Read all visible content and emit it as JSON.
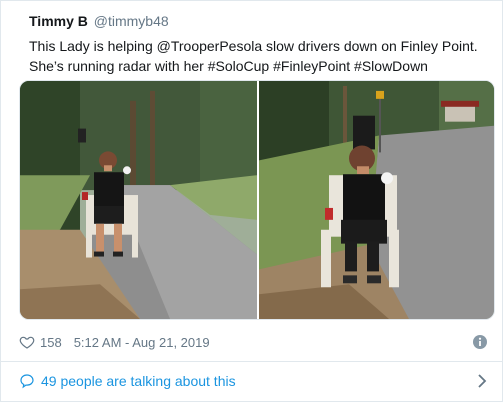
{
  "author": {
    "display_name": "Timmy B",
    "handle": "@timmyb48"
  },
  "tweet": {
    "line1": "This Lady is helping @TrooperPesola slow drivers down on Finley Point.",
    "line2": "She’s running radar with her #SoloCup #FinleyPoint #SlowDown"
  },
  "meta": {
    "like_count": "158",
    "timestamp": "5:12 AM - Aug 21, 2019"
  },
  "conversation": {
    "label": "49 people are talking about this"
  },
  "icons": {
    "heart": "heart-icon",
    "info": "info-icon",
    "bubble": "speech-bubble-icon",
    "chevron": "chevron-right-icon"
  },
  "colors": {
    "link": "#1b95e0",
    "secondary_text": "#657786",
    "border": "#e1e8ed"
  }
}
